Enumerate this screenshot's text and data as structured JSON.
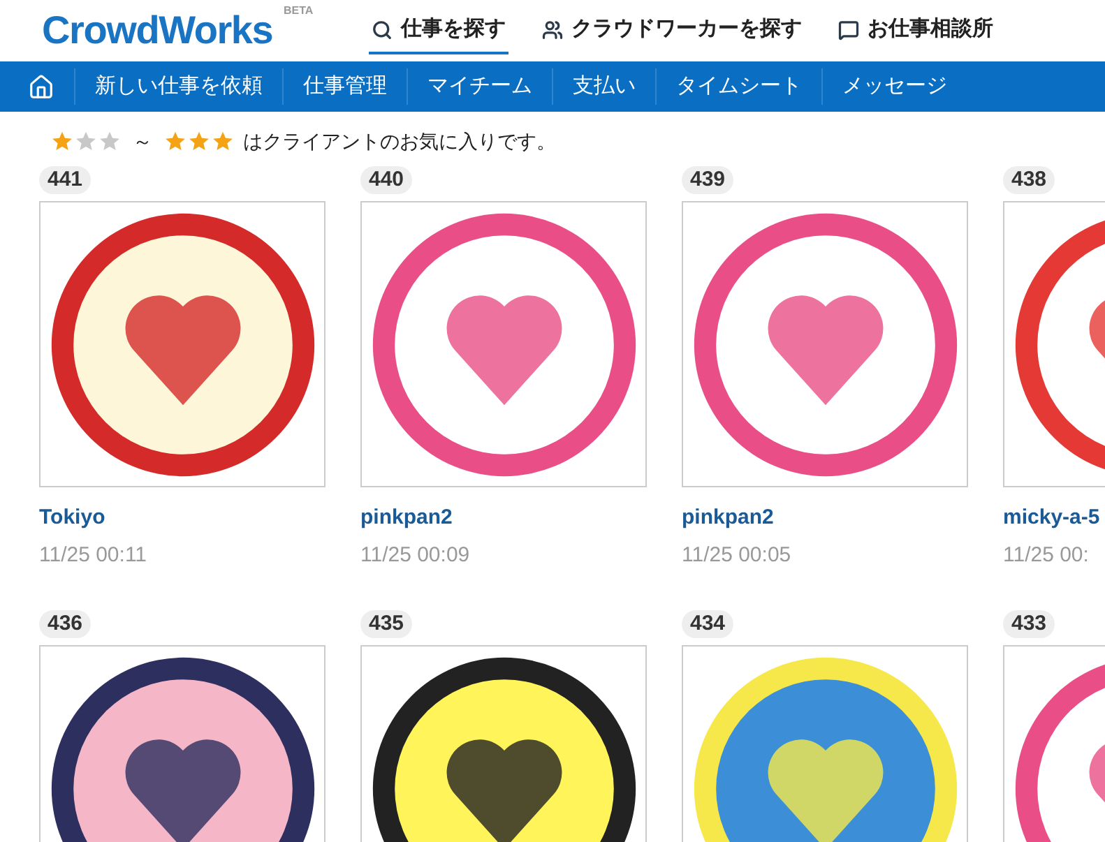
{
  "logo": {
    "name": "CrowdWorks",
    "badge": "BETA"
  },
  "header_tabs": [
    {
      "label": "仕事を探す",
      "selected": true
    },
    {
      "label": "クラウドワーカーを探す",
      "selected": false
    },
    {
      "label": "お仕事相談所",
      "selected": false
    }
  ],
  "nav": {
    "items": [
      "新しい仕事を依頼",
      "仕事管理",
      "マイチーム",
      "支払い",
      "タイムシート",
      "メッセージ"
    ]
  },
  "legend": {
    "from": {
      "stars": 1
    },
    "separator": "～",
    "to": {
      "stars": 3
    },
    "text": "はクライアントのお気に入りです。"
  },
  "entries": [
    {
      "number": "441",
      "author": "Tokiyo",
      "time": "11/25 00:11"
    },
    {
      "number": "440",
      "author": "pinkpan2",
      "time": "11/25 00:09"
    },
    {
      "number": "439",
      "author": "pinkpan2",
      "time": "11/25 00:05"
    },
    {
      "number": "438",
      "author": "micky-a-5",
      "time": "11/25 00:"
    },
    {
      "number": "436"
    },
    {
      "number": "435"
    },
    {
      "number": "434"
    },
    {
      "number": "433"
    }
  ]
}
